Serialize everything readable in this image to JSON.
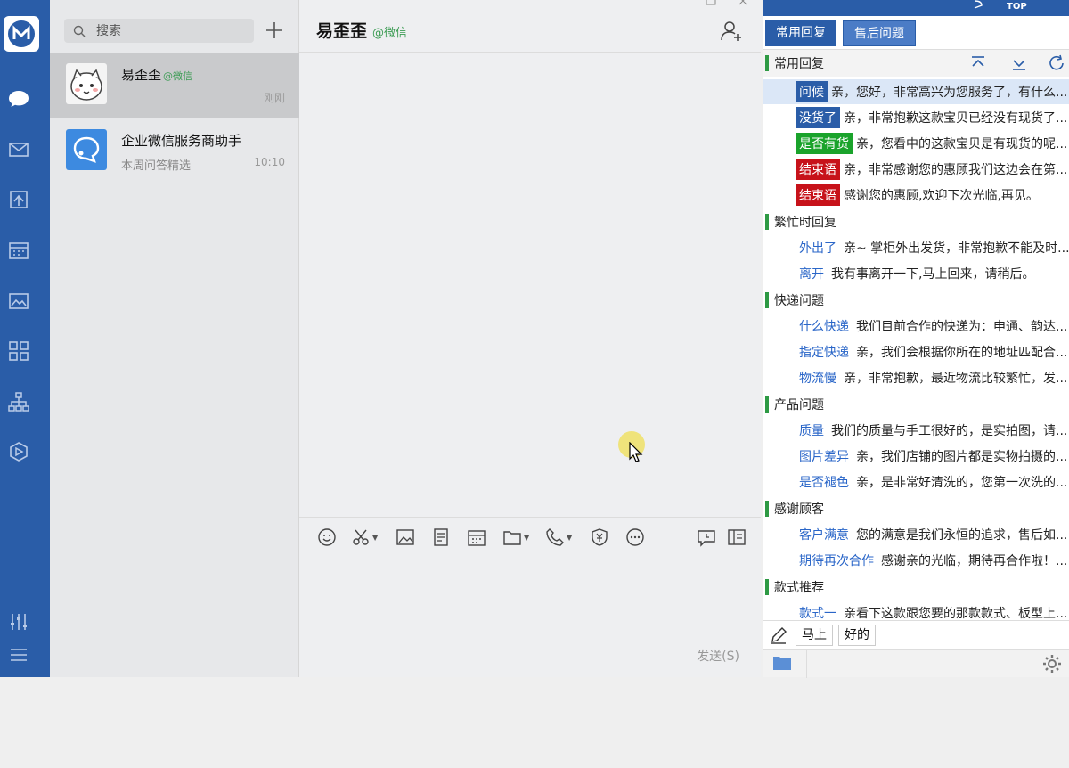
{
  "conversations": [
    {
      "name": "易歪歪",
      "tag": "@微信",
      "time": "刚刚",
      "sub": ""
    },
    {
      "name": "企业微信服务商助手",
      "tag": "",
      "time": "10:10",
      "sub": "本周问答精选"
    }
  ],
  "search": {
    "placeholder": "搜索"
  },
  "chat": {
    "title": "易歪歪",
    "tag": "@微信",
    "send_label": "发送(S)"
  },
  "panel": {
    "top_label": "TOP",
    "tabs": [
      "常用回复",
      "售后问题"
    ],
    "categories": [
      {
        "title": "常用回复",
        "items": [
          {
            "key": "问候",
            "style": "blue",
            "text": "亲，您好，非常高兴为您服务了，有什么..."
          },
          {
            "key": "没货了",
            "style": "blue",
            "text": "亲，非常抱歉这款宝贝已经没有现货了..."
          },
          {
            "key": "是否有货",
            "style": "green",
            "text": "亲，您看中的这款宝贝是有现货的呢..."
          },
          {
            "key": "结束语",
            "style": "red",
            "text": "亲，非常感谢您的惠顾我们这边会在第..."
          },
          {
            "key": "结束语",
            "style": "red",
            "text": "感谢您的惠顾,欢迎下次光临,再见。"
          }
        ]
      },
      {
        "title": "繁忙时回复",
        "items": [
          {
            "key": "外出了",
            "style": "link",
            "text": "亲~ 掌柜外出发货，非常抱歉不能及时..."
          },
          {
            "key": "离开",
            "style": "link",
            "text": "我有事离开一下,马上回来，请稍后。"
          }
        ]
      },
      {
        "title": "快递问题",
        "items": [
          {
            "key": "什么快递",
            "style": "link",
            "text": "我们目前合作的快递为：申通、韵达..."
          },
          {
            "key": "指定快递",
            "style": "link",
            "text": "亲，我们会根据你所在的地址匹配合..."
          },
          {
            "key": "物流慢",
            "style": "link",
            "text": "亲，非常抱歉，最近物流比较繁忙，发..."
          }
        ]
      },
      {
        "title": "产品问题",
        "items": [
          {
            "key": "质量",
            "style": "link",
            "text": "我们的质量与手工很好的，是实拍图，请..."
          },
          {
            "key": "图片差异",
            "style": "link",
            "text": "亲，我们店铺的图片都是实物拍摄的..."
          },
          {
            "key": "是否褪色",
            "style": "link",
            "text": "亲，是非常好清洗的，您第一次洗的..."
          }
        ]
      },
      {
        "title": "感谢顾客",
        "items": [
          {
            "key": "客户满意",
            "style": "link",
            "text": "您的满意是我们永恒的追求，售后如..."
          },
          {
            "key": "期待再次合作",
            "style": "link",
            "text": "感谢亲的光临，期待再合作啦！..."
          }
        ]
      },
      {
        "title": "款式推荐",
        "items": [
          {
            "key": "款式一",
            "style": "link",
            "text": "亲看下这款跟您要的那款款式、板型上..."
          }
        ]
      }
    ],
    "quick_buttons": [
      "马上",
      "好的"
    ]
  },
  "colors": {
    "brand": "#2a5da8",
    "wechat_green": "#3a9b52",
    "category_bar": "#2e9a44"
  }
}
